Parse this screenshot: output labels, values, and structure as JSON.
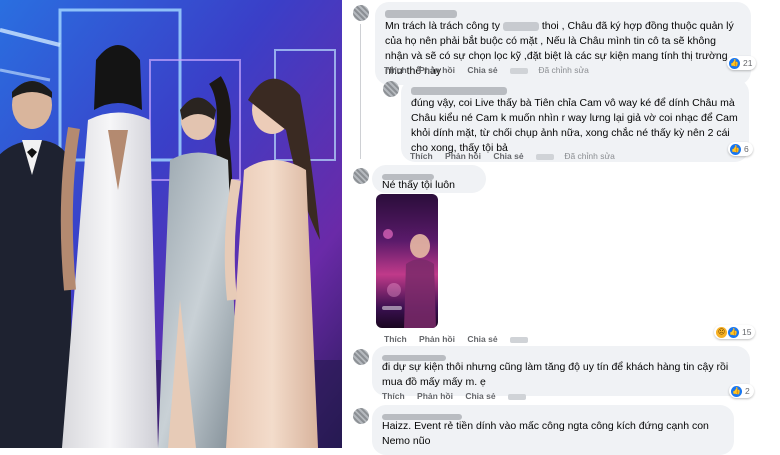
{
  "comments": [
    {
      "text_before": "Mn trách là trách công ty",
      "text_after": "thoi , Châu đã ký hợp đồng thuộc quản lý của họ nên phải bắt buộc có mặt , Nếu là Châu mình tin cô ta sẽ không nhận và sẽ có sự chọn lọc kỹ ,đặt biệt là các sự kiện mang tính thị trường như thế này",
      "actions": {
        "like": "Thích",
        "reply": "Phản hồi",
        "share": "Chia sẻ",
        "edited": "Đã chỉnh sửa"
      },
      "reaction_count": "21"
    },
    {
      "text": "đúng vậy, coi Live thấy bà Tiên chỉa Cam vô way ké để dính Châu mà Châu kiểu né Cam k muốn nhìn r way lưng lại giả vờ coi nhạc để Cam khỏi dính mặt, từ chối chụp ảnh nữa, xong chắc né thấy kỳ nên 2 cái cho xong, thấy tội bả",
      "actions": {
        "like": "Thích",
        "reply": "Phản hồi",
        "share": "Chia sẻ",
        "edited": "Đã chỉnh sửa"
      },
      "reaction_count": "6"
    },
    {
      "text": "Né thấy tội luôn",
      "actions": {
        "like": "Thích",
        "reply": "Phản hồi",
        "share": "Chia sẻ"
      },
      "reaction_count": "15"
    },
    {
      "text": "đi dự sự kiện thôi nhưng cũng làm tăng độ uy tín để khách hàng tin cậy rồi mua đồ mấy mấy m. ẹ",
      "actions": {
        "like": "Thích",
        "reply": "Phản hồi",
        "share": "Chia sẻ"
      },
      "reaction_count": "2"
    },
    {
      "text": "Haizz. Event rẻ tiền dính vào mấc công ngta công kích đứng cạnh con Nemo nũo"
    }
  ],
  "icons": {
    "like": "thumbs-up-icon",
    "sad": "sad-face-icon",
    "more": "more-options-icon"
  },
  "colors": {
    "bubble": "#f0f2f5",
    "like_blue": "#1877f2",
    "action_gray": "#65676b"
  }
}
